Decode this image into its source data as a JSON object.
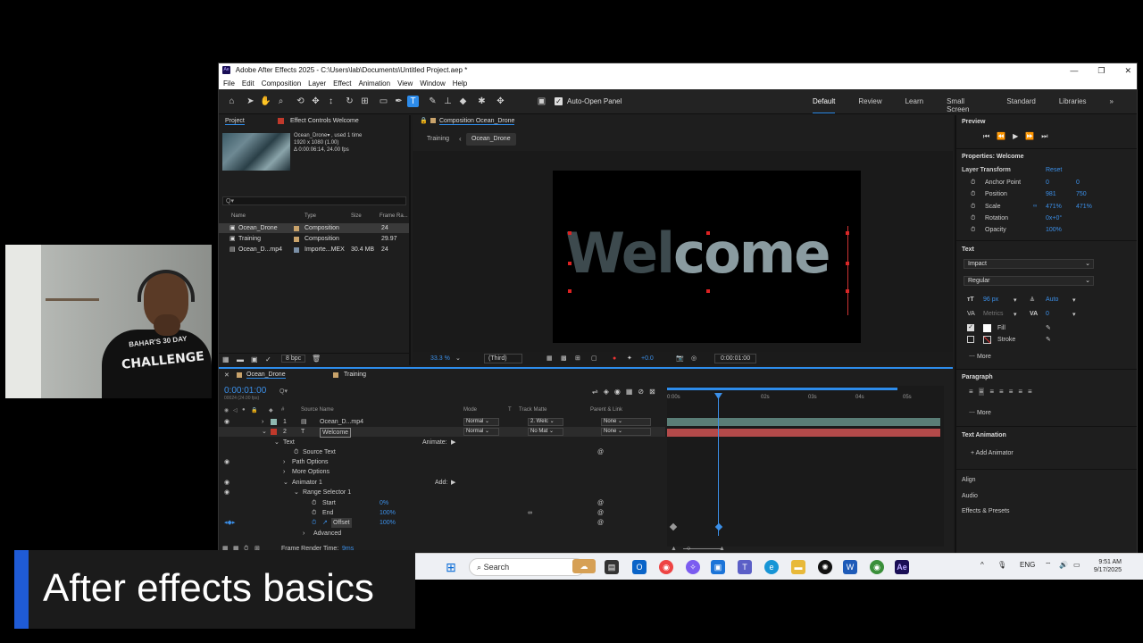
{
  "window": {
    "title": "Adobe After Effects 2025 - C:\\Users\\lab\\Documents\\Untitled Project.aep *",
    "app_icon": "Ae",
    "controls": [
      "—",
      "❐",
      "✕"
    ]
  },
  "menu": [
    "File",
    "Edit",
    "Composition",
    "Layer",
    "Effect",
    "Animation",
    "View",
    "Window",
    "Help"
  ],
  "toolbar": {
    "auto_open": "Auto-Open Panel",
    "workspaces": [
      "Default",
      "Review",
      "Learn",
      "Small Screen",
      "Standard",
      "Libraries"
    ],
    "more": "»"
  },
  "project": {
    "tab_project": "Project",
    "tab_effect_controls": "Effect Controls Welcome",
    "info_name": "Ocean_Drone▾ , used 1 time",
    "info_res": "1920 x 1080 (1.00)",
    "info_dur": "Δ 0:00:06:14, 24.00 fps",
    "search_placeholder": "Q▾",
    "columns": [
      "Name",
      "Type",
      "Size",
      "Frame Ra..."
    ],
    "items": [
      {
        "name": "Ocean_Drone",
        "type": "Composition",
        "size": "",
        "fps": "24"
      },
      {
        "name": "Training",
        "type": "Composition",
        "size": "",
        "fps": "29.97"
      },
      {
        "name": "Ocean_D...mp4",
        "type": "Importe...MEX",
        "size": "30.4 MB",
        "fps": "24"
      }
    ],
    "bpc": "8 bpc"
  },
  "composition": {
    "tab": "Composition Ocean_Drone",
    "crumb_training": "Training",
    "crumb_ocean": "Ocean_Drone",
    "text_wel": "Wel",
    "text_come": "come",
    "zoom": "33.3 %",
    "resolution": "(Third)",
    "exposure": "+0.0",
    "timecode": "0:00:01:00"
  },
  "properties": {
    "preview_title": "Preview",
    "title": "Properties: Welcome",
    "layer_transform": "Layer Transform",
    "reset": "Reset",
    "rows": [
      {
        "label": "Anchor Point",
        "v1": "0",
        "v2": "0"
      },
      {
        "label": "Position",
        "v1": "981",
        "v2": "750"
      },
      {
        "label": "Scale",
        "v1": "471%",
        "v2": "471%"
      },
      {
        "label": "Rotation",
        "v1": "0x+0°",
        "v2": ""
      },
      {
        "label": "Opacity",
        "v1": "100%",
        "v2": ""
      }
    ],
    "text_title": "Text",
    "font": "Impact",
    "style": "Regular",
    "font_size": "96 px",
    "leading": "Auto",
    "kerning": "Metrics",
    "tracking": "0",
    "fill": "Fill",
    "stroke": "Stroke",
    "more": "More",
    "paragraph": "Paragraph",
    "text_animation": "Text Animation",
    "add_animator": "Add Animator",
    "align": "Align",
    "audio": "Audio",
    "effects_presets": "Effects & Presets"
  },
  "timeline": {
    "tab_ocean": "Ocean_Drone",
    "tab_training": "Training",
    "timecode": "0:00:01:00",
    "subtime": "00024 (24.00 fps)",
    "search": "Q▾",
    "columns": {
      "source": "Source Name",
      "mode": "Mode",
      "t": "T",
      "track_matte": "Track Matte",
      "parent": "Parent & Link"
    },
    "layers": [
      {
        "num": "1",
        "name": "Ocean_D...mp4",
        "mode": "Normal",
        "matte": "2. Welc",
        "parent": "None"
      },
      {
        "num": "2",
        "name": "Welcome",
        "mode": "Normal",
        "matte": "No Mat",
        "parent": "None"
      }
    ],
    "props": {
      "text": "Text",
      "animate": "Animate:",
      "source_text": "Source Text",
      "path_options": "Path Options",
      "more_options": "More Options",
      "animator": "Animator 1",
      "add": "Add:",
      "range_selector": "Range Selector 1",
      "start": "Start",
      "start_val": "0%",
      "end": "End",
      "end_val": "100%",
      "offset": "Offset",
      "offset_val": "100%",
      "advanced": "Advanced"
    },
    "ruler": [
      "0:00s",
      "",
      "02s",
      "03s",
      "04s",
      "05s"
    ],
    "render_time_label": "Frame Render Time:",
    "render_time": "9ms"
  },
  "taskbar": {
    "search": "Search",
    "lang": "ENG",
    "time": "9:51 AM",
    "date": "9/17/2025"
  },
  "webcam": {
    "shirt_top": "BAHAR'S 30 DAY",
    "shirt_main": "CHALLENGE"
  },
  "caption": "After effects basics",
  "colors": {
    "accent": "#2d8ceb",
    "caption_bar": "#1f5bd6",
    "layer_red": "#b34a4a",
    "layer_teal": "#5a7d76"
  }
}
